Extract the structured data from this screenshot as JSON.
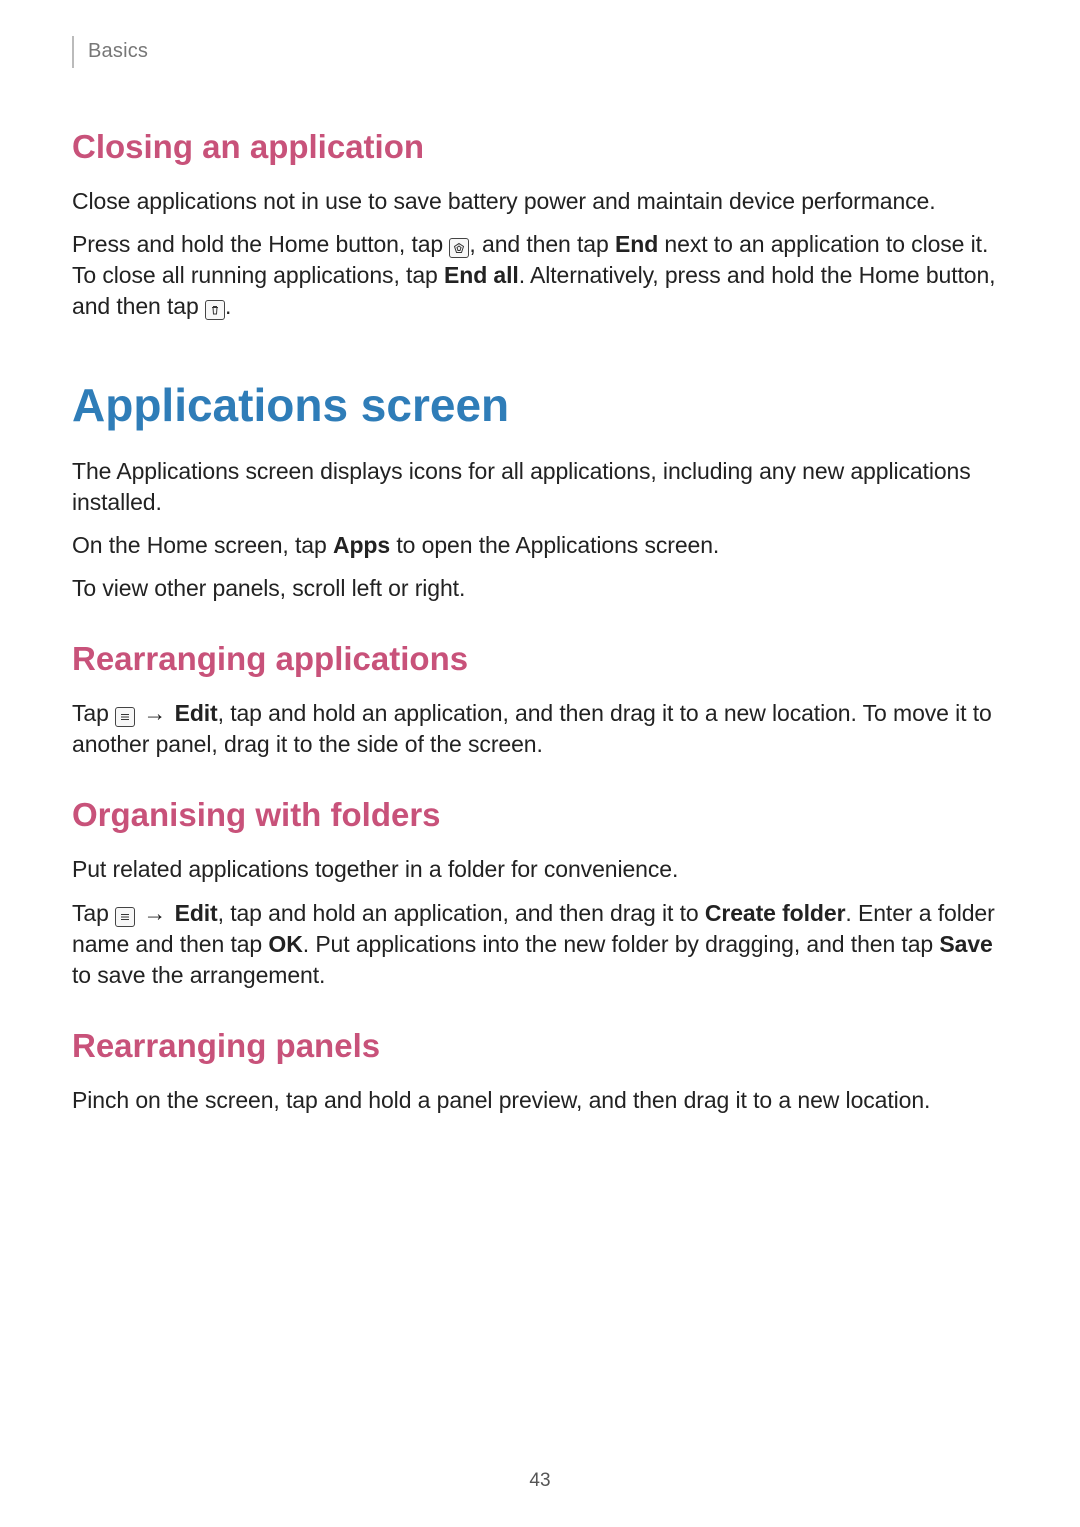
{
  "header": {
    "breadcrumb": "Basics"
  },
  "sections": {
    "closing": {
      "title": "Closing an application",
      "p1": "Close applications not in use to save battery power and maintain device performance.",
      "p2a": "Press and hold the Home button, tap ",
      "p2b": ", and then tap ",
      "p2_end": "End",
      "p2c": " next to an application to close it. To close all running applications, tap ",
      "p2_endall": "End all",
      "p2d": ". Alternatively, press and hold the Home button, and then tap ",
      "p2e": "."
    },
    "apps_screen": {
      "title": "Applications screen",
      "p1": "The Applications screen displays icons for all applications, including any new applications installed.",
      "p2a": "On the Home screen, tap ",
      "p2_apps": "Apps",
      "p2b": " to open the Applications screen.",
      "p3": "To view other panels, scroll left or right."
    },
    "rearranging_apps": {
      "title": "Rearranging applications",
      "p1a": "Tap ",
      "arrow": "→",
      "p1_edit": "Edit",
      "p1b": ", tap and hold an application, and then drag it to a new location. To move it to another panel, drag it to the side of the screen."
    },
    "organising": {
      "title": "Organising with folders",
      "p1": "Put related applications together in a folder for convenience.",
      "p2a": "Tap ",
      "arrow": "→",
      "p2_edit": "Edit",
      "p2b": ", tap and hold an application, and then drag it to ",
      "p2_create": "Create folder",
      "p2c": ". Enter a folder name and then tap ",
      "p2_ok": "OK",
      "p2d": ". Put applications into the new folder by dragging, and then tap ",
      "p2_save": "Save",
      "p2e": " to save the arrangement."
    },
    "rearranging_panels": {
      "title": "Rearranging panels",
      "p1": "Pinch on the screen, tap and hold a panel preview, and then drag it to a new location."
    }
  },
  "footer": {
    "page_number": "43"
  }
}
